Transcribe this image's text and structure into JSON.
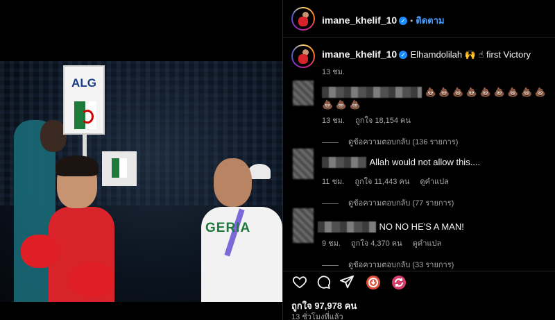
{
  "header": {
    "username": "imane_khelif_10",
    "separator": "•",
    "follow_label": "ติดตาม"
  },
  "photo": {
    "sign_text": "ALG",
    "jersey_text": "GERIA"
  },
  "caption": {
    "username": "imane_khelif_10",
    "text": "Elhamdolilah 🙌 ☝ first Victory",
    "time": "13 ชม."
  },
  "comments": [
    {
      "text": "💩 💩 💩 💩 💩 💩 💩 💩 💩 💩 💩 💩",
      "time": "13 ชม.",
      "likes": "ถูกใจ 18,154 คน",
      "translate": "",
      "replies": "ดูข้อความตอบกลับ (136 รายการ)"
    },
    {
      "text": "Allah would not allow this....",
      "time": "11 ชม.",
      "likes": "ถูกใจ 11,443 คน",
      "translate": "ดูคำแปล",
      "replies": "ดูข้อความตอบกลับ (77 รายการ)"
    },
    {
      "text": "NO NO HE'S A MAN!",
      "time": "9 ชม.",
      "likes": "ถูกใจ 4,370 คน",
      "translate": "ดูคำแปล",
      "replies": "ดูข้อความตอบกลับ (33 รายการ)"
    }
  ],
  "actions": {
    "icons": [
      "heart-icon",
      "comment-icon",
      "share-icon",
      "reaction-icon-1",
      "reaction-icon-2"
    ]
  },
  "footer": {
    "likes": "ถูกใจ 97,978 คน",
    "posted": "13 ชั่วโมงที่แล้ว"
  },
  "colors": {
    "background": "#000000",
    "link": "#4a9eff",
    "muted": "#a8a8a8",
    "verified": "#1a8cff"
  }
}
